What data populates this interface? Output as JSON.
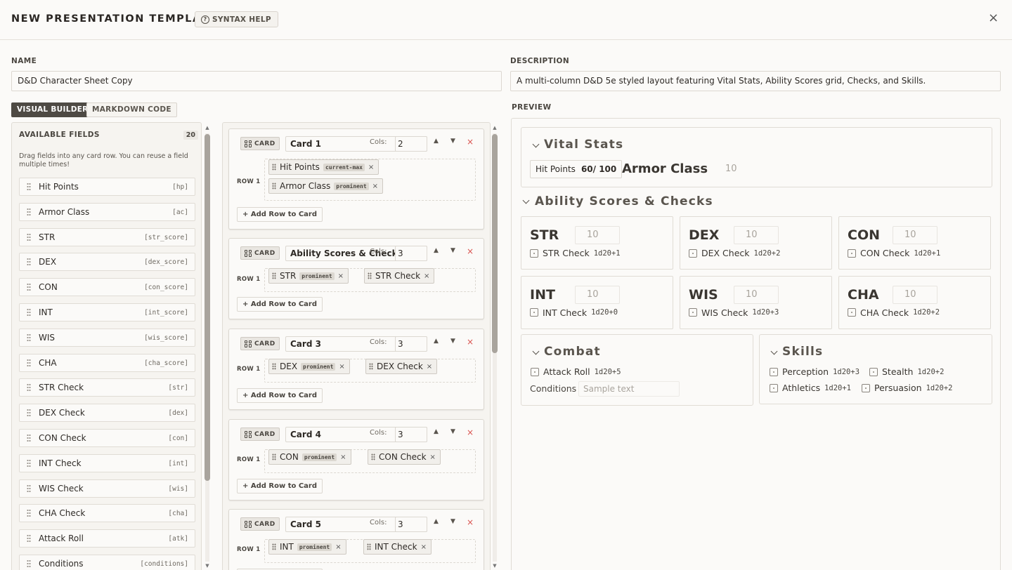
{
  "header": {
    "title": "NEW PRESENTATION TEMPLATE",
    "syntax_help": "SYNTAX HELP",
    "close": "×"
  },
  "form": {
    "name_label": "NAME",
    "name_value": "D&D Character Sheet Copy",
    "description_label": "DESCRIPTION",
    "description_value": "A multi-column D&D 5e styled layout featuring Vital Stats, Ability Scores grid, Checks, and Skills."
  },
  "tabs": {
    "visual": "VISUAL BUILDER",
    "markdown": "MARKDOWN CODE",
    "preview": "PREVIEW"
  },
  "available": {
    "title": "AVAILABLE FIELDS",
    "count": "20",
    "hint": "Drag fields into any card row. You can reuse a field multiple times!",
    "fields": [
      {
        "name": "Hit Points",
        "key": "[hp]"
      },
      {
        "name": "Armor Class",
        "key": "[ac]"
      },
      {
        "name": "STR",
        "key": "[str_score]"
      },
      {
        "name": "DEX",
        "key": "[dex_score]"
      },
      {
        "name": "CON",
        "key": "[con_score]"
      },
      {
        "name": "INT",
        "key": "[int_score]"
      },
      {
        "name": "WIS",
        "key": "[wis_score]"
      },
      {
        "name": "CHA",
        "key": "[cha_score]"
      },
      {
        "name": "STR Check",
        "key": "[str]"
      },
      {
        "name": "DEX Check",
        "key": "[dex]"
      },
      {
        "name": "CON Check",
        "key": "[con]"
      },
      {
        "name": "INT Check",
        "key": "[int]"
      },
      {
        "name": "WIS Check",
        "key": "[wis]"
      },
      {
        "name": "CHA Check",
        "key": "[cha]"
      },
      {
        "name": "Attack Roll",
        "key": "[atk]"
      },
      {
        "name": "Conditions",
        "key": "[conditions]"
      }
    ]
  },
  "builder": {
    "card_badge": "CARD",
    "cols_label": "Cols:",
    "row_label": "ROW 1",
    "add_row": "+ Add Row to Card",
    "up": "▲",
    "down": "▼",
    "remove": "×",
    "cards": [
      {
        "title": "Card 1",
        "cols": "2",
        "chips": [
          {
            "name": "Hit Points",
            "tag": "current-max"
          },
          {
            "name": "Armor Class",
            "tag": "prominent"
          }
        ]
      },
      {
        "title": "Ability Scores & Checks",
        "cols": "3",
        "chips": [
          {
            "name": "STR",
            "tag": "prominent"
          },
          {
            "name": "STR Check",
            "tag": ""
          }
        ]
      },
      {
        "title": "Card 3",
        "cols": "3",
        "chips": [
          {
            "name": "DEX",
            "tag": "prominent"
          },
          {
            "name": "DEX Check",
            "tag": ""
          }
        ]
      },
      {
        "title": "Card 4",
        "cols": "3",
        "chips": [
          {
            "name": "CON",
            "tag": "prominent"
          },
          {
            "name": "CON Check",
            "tag": ""
          }
        ]
      },
      {
        "title": "Card 5",
        "cols": "3",
        "chips": [
          {
            "name": "INT",
            "tag": "prominent"
          },
          {
            "name": "INT Check",
            "tag": ""
          }
        ]
      }
    ]
  },
  "preview": {
    "vital": {
      "title": "Vital Stats",
      "hp_label": "Hit Points",
      "hp_value": "60/ 100",
      "ac_label": "Armor Class",
      "ac_value": "10"
    },
    "abilities": {
      "title": "Ability Scores & Checks",
      "scores": [
        {
          "name": "STR",
          "value": "10",
          "check": "STR Check",
          "roll": "1d20+1"
        },
        {
          "name": "DEX",
          "value": "10",
          "check": "DEX Check",
          "roll": "1d20+2"
        },
        {
          "name": "CON",
          "value": "10",
          "check": "CON Check",
          "roll": "1d20+1"
        },
        {
          "name": "INT",
          "value": "10",
          "check": "INT Check",
          "roll": "1d20+0"
        },
        {
          "name": "WIS",
          "value": "10",
          "check": "WIS Check",
          "roll": "1d20+3"
        },
        {
          "name": "CHA",
          "value": "10",
          "check": "CHA Check",
          "roll": "1d20+2"
        }
      ]
    },
    "combat": {
      "title": "Combat",
      "attack_label": "Attack Roll",
      "attack_roll": "1d20+5",
      "conditions_label": "Conditions",
      "conditions_placeholder": "Sample text"
    },
    "skills": {
      "title": "Skills",
      "items": [
        {
          "name": "Perception",
          "roll": "1d20+3"
        },
        {
          "name": "Stealth",
          "roll": "1d20+2"
        },
        {
          "name": "Athletics",
          "roll": "1d20+1"
        },
        {
          "name": "Persuasion",
          "roll": "1d20+2"
        }
      ]
    }
  }
}
